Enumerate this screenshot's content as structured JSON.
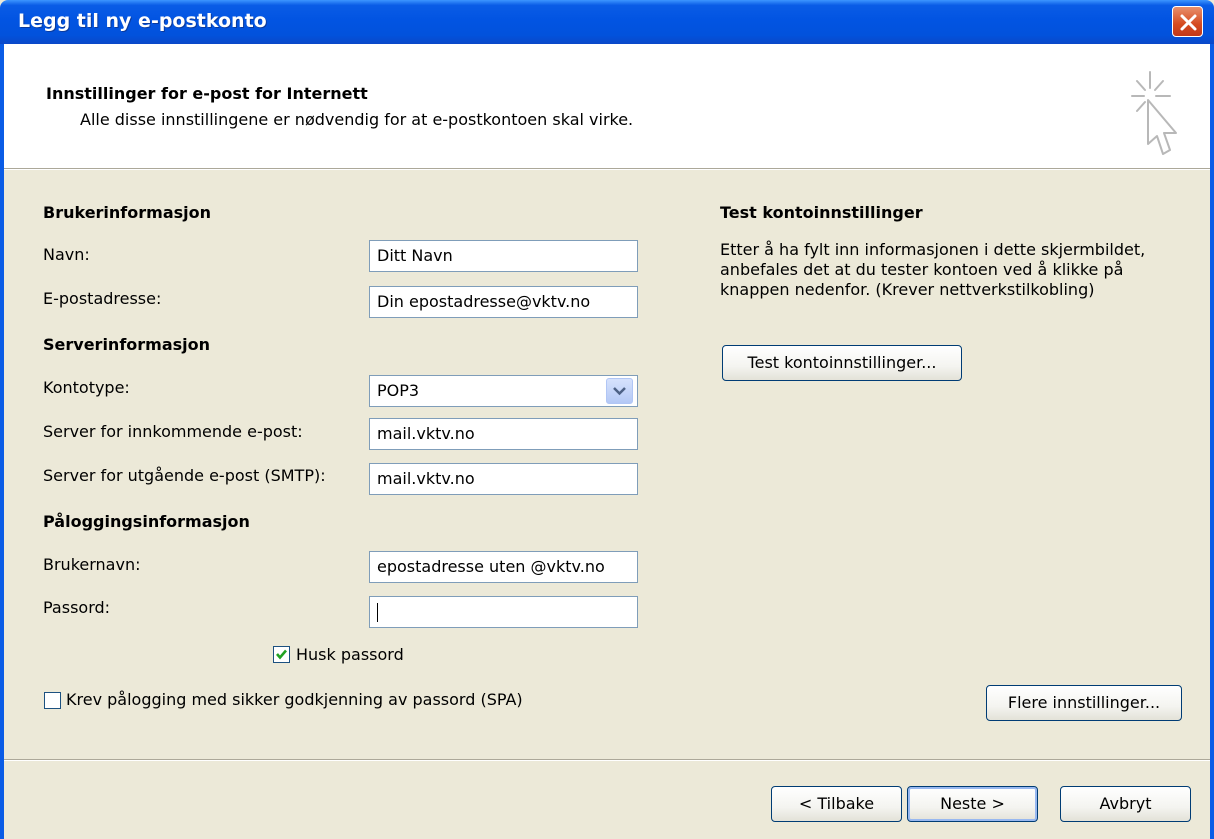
{
  "window": {
    "title": "Legg til ny e-postkonto"
  },
  "header": {
    "title": "Innstillinger for e-post for Internett",
    "subtitle": "Alle disse innstillingene er nødvendig for at e-postkontoen skal virke."
  },
  "user_info": {
    "section": "Brukerinformasjon",
    "name_label": "Navn:",
    "name_value": "Ditt Navn",
    "email_label": "E-postadresse:",
    "email_value": "Din epostadresse@vktv.no"
  },
  "server_info": {
    "section": "Serverinformasjon",
    "account_type_label": "Kontotype:",
    "account_type_value": "POP3",
    "incoming_label": "Server for innkommende e-post:",
    "incoming_value": "mail.vktv.no",
    "outgoing_label": "Server for utgående e-post (SMTP):",
    "outgoing_value": "mail.vktv.no"
  },
  "login_info": {
    "section": "Påloggingsinformasjon",
    "username_label": "Brukernavn:",
    "username_value": "epostadresse uten @vktv.no",
    "password_label": "Passord:",
    "password_value": "",
    "remember_label": "Husk passord",
    "remember_checked": true,
    "spa_label": "Krev pålogging med sikker godkjenning av passord (SPA)",
    "spa_checked": false
  },
  "test": {
    "section": "Test kontoinnstillinger",
    "description_lines": [
      "Etter å ha fylt inn informasjonen i dette skjermbildet,",
      "anbefales det at du tester kontoen ved å klikke på",
      "knappen nedenfor. (Krever nettverkstilkobling)"
    ],
    "button": "Test kontoinnstillinger..."
  },
  "more_settings_button": "Flere innstillinger...",
  "footer": {
    "back_button": "< Tilbake",
    "next_button": "Neste >",
    "cancel_button": "Avbryt"
  },
  "colors": {
    "titlebar": "#0254e2",
    "dialog_bg": "#ece9d8",
    "close_button": "#d54b20",
    "field_border": "#7f9db9"
  }
}
